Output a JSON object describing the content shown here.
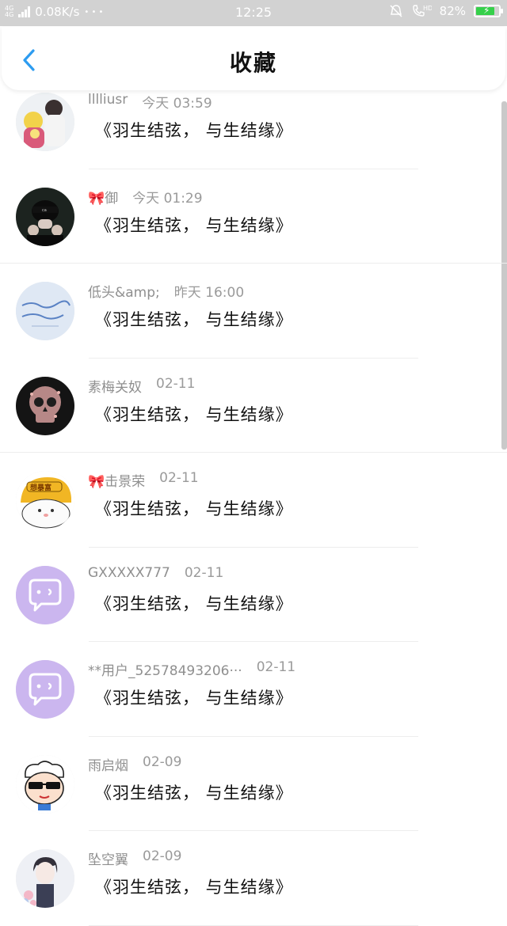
{
  "status_bar": {
    "network": "4G 4G",
    "speed": "0.08K/s",
    "dots": "• • •",
    "time": "12:25",
    "hd": "HD",
    "battery_percent": "82%",
    "battery_level": 0.82,
    "battery_color": "#35d04a"
  },
  "header": {
    "title": "收藏",
    "back_icon": "chevron-left-icon",
    "accent": "#2d9cf0"
  },
  "items": [
    {
      "name": "lllliusr",
      "time": "今天 03:59",
      "content": "《羽生结弦， 与生结缘》",
      "avatar": "photo-girl"
    },
    {
      "name": "🎀御",
      "time": "今天 01:29",
      "content": "《羽生结弦， 与生结缘》",
      "avatar": "photo-black-hat"
    },
    {
      "name": "低头&amp;",
      "time": "昨天 16:00",
      "content": "《羽生结弦， 与生结缘》",
      "avatar": "photo-blue-text"
    },
    {
      "name": "素梅关奴",
      "time": "02-11",
      "content": "《羽生结弦， 与生结缘》",
      "avatar": "photo-floral-skull"
    },
    {
      "name": "🎀击景荣",
      "time": "02-11",
      "content": "《羽生结弦， 与生结缘》",
      "avatar": "photo-cat-helmet"
    },
    {
      "name": "GXXXXX777",
      "time": "02-11",
      "content": "《羽生结弦， 与生结缘》",
      "avatar": "default-chat"
    },
    {
      "name": "**用户_52578493206···",
      "time": "02-11",
      "content": "《羽生结弦， 与生结缘》",
      "avatar": "default-chat"
    },
    {
      "name": "雨启烟",
      "time": "02-09",
      "content": "《羽生结弦， 与生结缘》",
      "avatar": "photo-cartoon-sunglasses"
    },
    {
      "name": "坠空翼",
      "time": "02-09",
      "content": "《羽生结弦， 与生结缘》",
      "avatar": "photo-anime-boy"
    }
  ]
}
